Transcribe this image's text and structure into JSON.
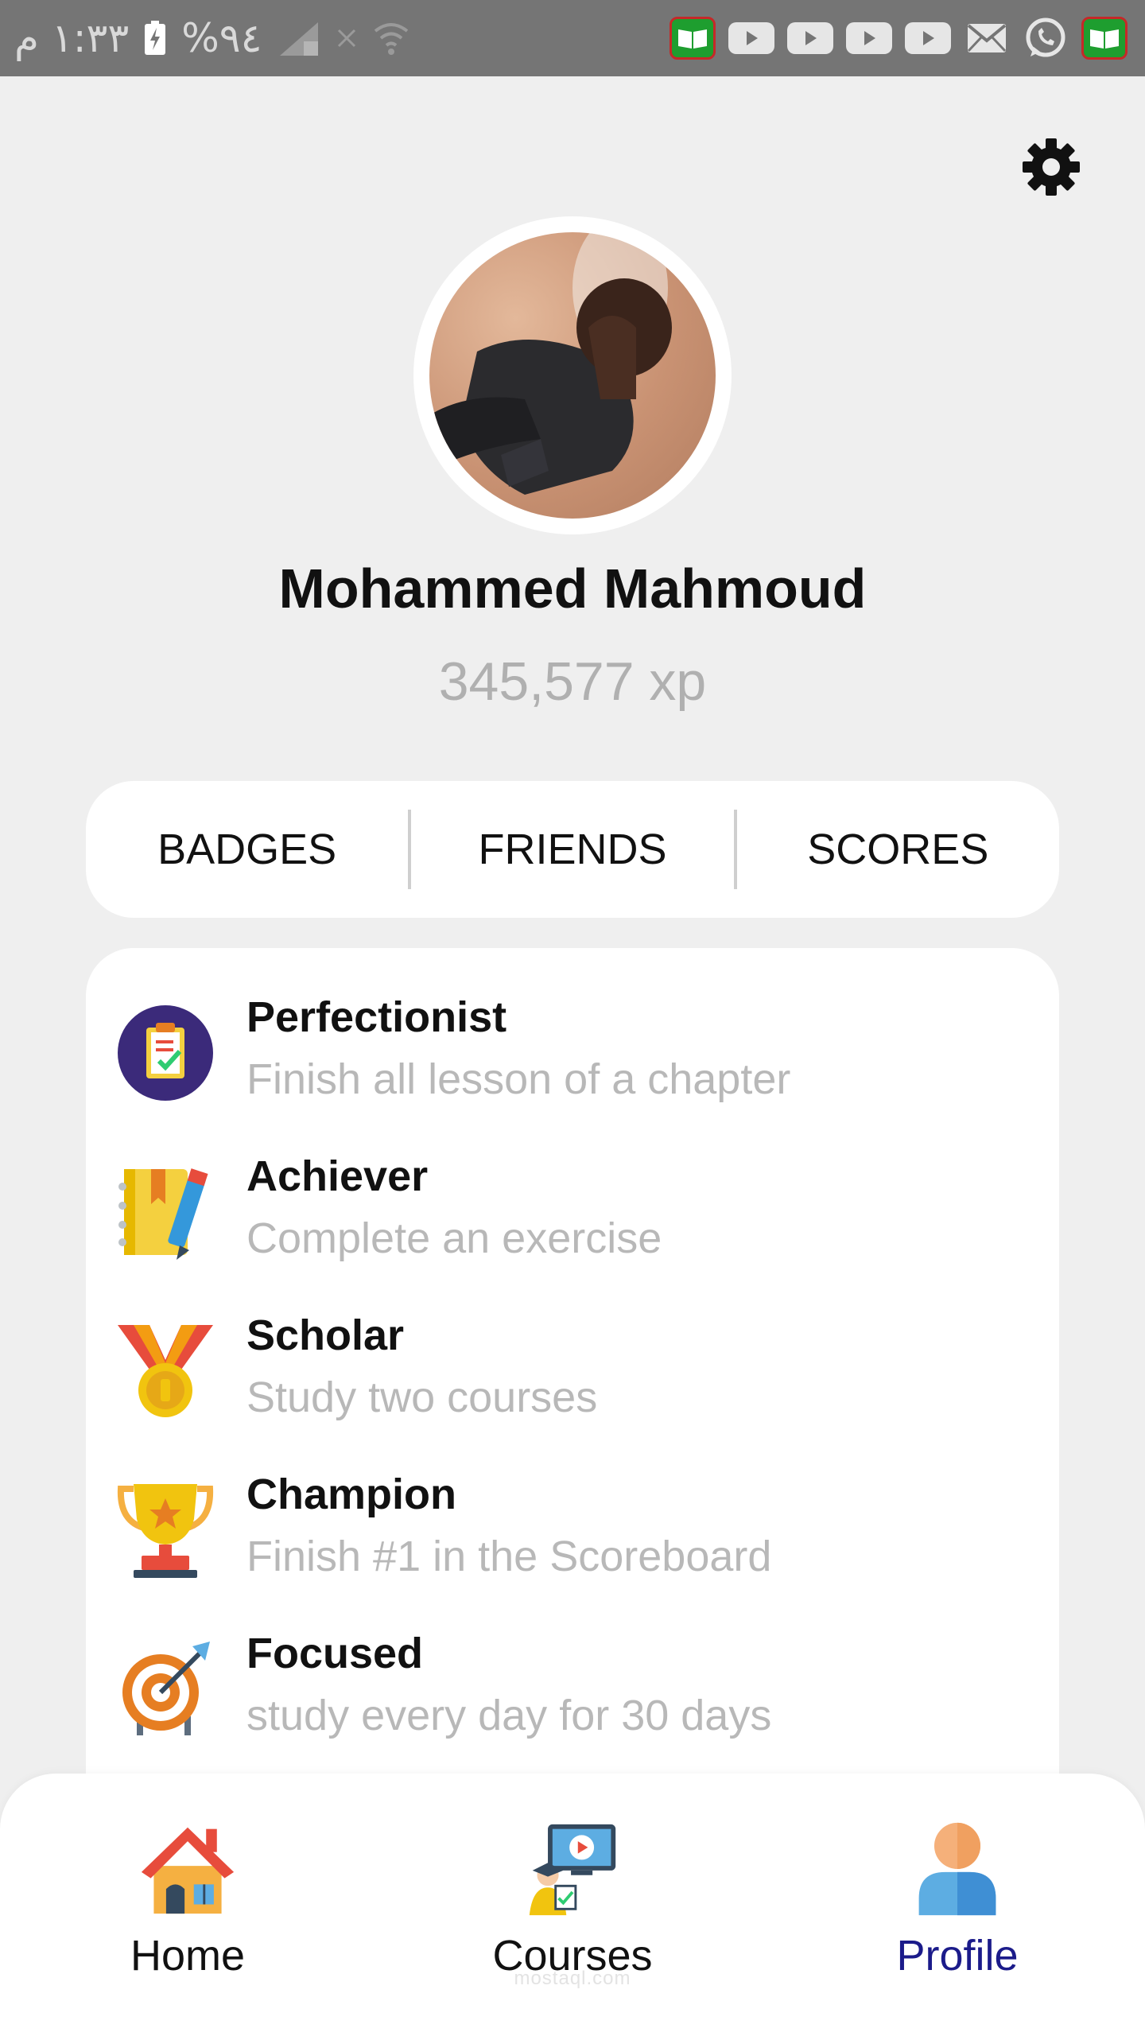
{
  "status_bar": {
    "time": "١:٣٣ م",
    "battery": "%٩٤"
  },
  "colors": {
    "background": "#efefef",
    "card": "#ffffff",
    "active_nav": "#1b1b8a",
    "muted_text": "#b8b8b8"
  },
  "profile": {
    "name": "Mohammed Mahmoud",
    "xp": "345,577 xp"
  },
  "tabs": [
    {
      "label": "BADGES"
    },
    {
      "label": "FRIENDS"
    },
    {
      "label": "SCORES"
    }
  ],
  "badges": [
    {
      "title": "Perfectionist",
      "description": "Finish all lesson of a chapter",
      "icon": "clipboard-check-icon"
    },
    {
      "title": "Achiever",
      "description": "Complete an exercise",
      "icon": "notebook-pencil-icon"
    },
    {
      "title": "Scholar",
      "description": "Study two courses",
      "icon": "medal-icon"
    },
    {
      "title": "Champion",
      "description": "Finish #1 in the Scoreboard",
      "icon": "trophy-icon"
    },
    {
      "title": "Focused",
      "description": "study every day for 30 days",
      "icon": "target-icon"
    }
  ],
  "nav": [
    {
      "label": "Home",
      "icon": "house-icon"
    },
    {
      "label": "Courses",
      "icon": "courses-icon"
    },
    {
      "label": "Profile",
      "icon": "user-icon",
      "active": true
    }
  ],
  "watermark": "mostaql.com"
}
